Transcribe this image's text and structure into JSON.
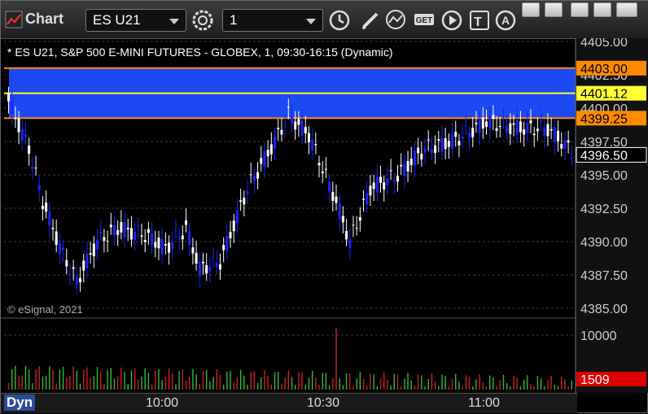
{
  "toolbar": {
    "title": "Chart",
    "symbol": "ES U21",
    "interval": "1"
  },
  "chart": {
    "header": "* ES U21, S&P 500 E-MINI FUTURES - GLOBEX, 1, 09:30-16:15 (Dynamic)",
    "copyright": "© eSignal, 2021",
    "price_ticks": [
      "4405.00",
      "4402.50",
      "4400.00",
      "4397.50",
      "4395.00",
      "4392.50",
      "4390.00",
      "4387.50",
      "4385.00"
    ],
    "volume_ticks": [
      "10000"
    ],
    "time_ticks": [
      "10:00",
      "10:30",
      "11:00"
    ],
    "mode_label": "Dyn",
    "levels": [
      {
        "value": "4403.00",
        "color": "#ff8a00"
      },
      {
        "value": "4401.12",
        "color": "#ffff33"
      },
      {
        "value": "4399.25",
        "color": "#ff8a00"
      },
      {
        "value": "4396.50",
        "color": "#ffffff"
      }
    ],
    "volume_label": "1509",
    "colors": {
      "up": "#ffffff",
      "down": "#1a24ff",
      "zone": "#1f4dff",
      "vol_up": "#33bb33",
      "vol_down": "#cc2222"
    }
  },
  "chart_data": {
    "type": "candlestick",
    "ylim": [
      4385,
      4406
    ],
    "x_ticks": [
      "10:00",
      "10:30",
      "11:00"
    ],
    "bars": 110
  }
}
